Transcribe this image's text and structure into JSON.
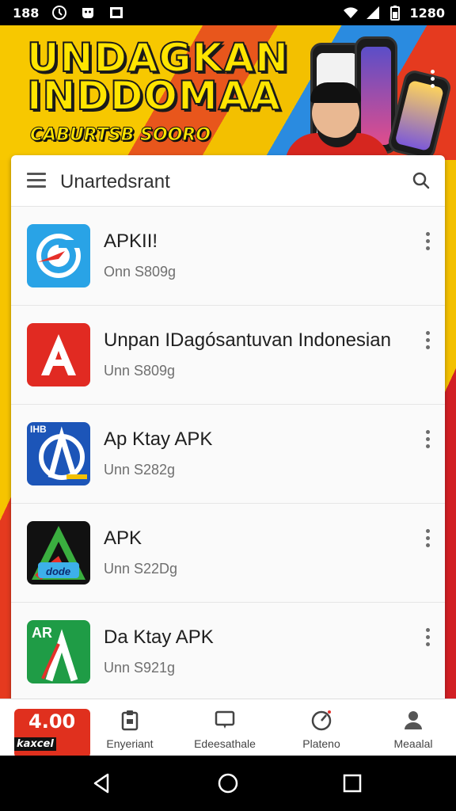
{
  "status_bar": {
    "left_text": "188",
    "time": "1280",
    "icons": [
      "alarm-icon",
      "notification-icon",
      "image-icon",
      "wifi-icon",
      "signal-icon",
      "battery-icon"
    ]
  },
  "banner": {
    "title_line1": "UNDAGKAN",
    "title_line2": "INDDOMAA",
    "subtitle": "CABURTSB SOORO"
  },
  "search": {
    "title": "Unartedsrant"
  },
  "apps": [
    {
      "name": "APKII!",
      "meta": "Onn S809g",
      "icon": "blue-circle-app-icon"
    },
    {
      "name": "Unpan IDagósantuvan Indonesian",
      "meta": "Unn S809g",
      "icon": "red-a-app-icon"
    },
    {
      "name": "Ap Ktay APK",
      "meta": "Unn S282g",
      "icon": "blue-a-app-icon",
      "icon_text": "IHB"
    },
    {
      "name": "APK",
      "meta": "Unn S22Dg",
      "icon": "green-triangle-app-icon",
      "icon_text": "dode"
    },
    {
      "name": "Da Ktay APK",
      "meta": "Unn S921g",
      "icon": "green-a-app-icon",
      "icon_text": "AR"
    }
  ],
  "promo": {
    "line1": "4.00",
    "line2": "kaxcel"
  },
  "bottom_nav": [
    {
      "label": "Enyeriant",
      "icon": "clipboard-icon"
    },
    {
      "label": "Edeesathale",
      "icon": "chat-icon"
    },
    {
      "label": "Plateno",
      "icon": "gauge-icon"
    },
    {
      "label": "Meaalal",
      "icon": "profile-icon"
    }
  ],
  "colors": {
    "accent_red": "#d6261f",
    "accent_yellow": "#f6c400",
    "accent_blue": "#1d7fd4"
  }
}
